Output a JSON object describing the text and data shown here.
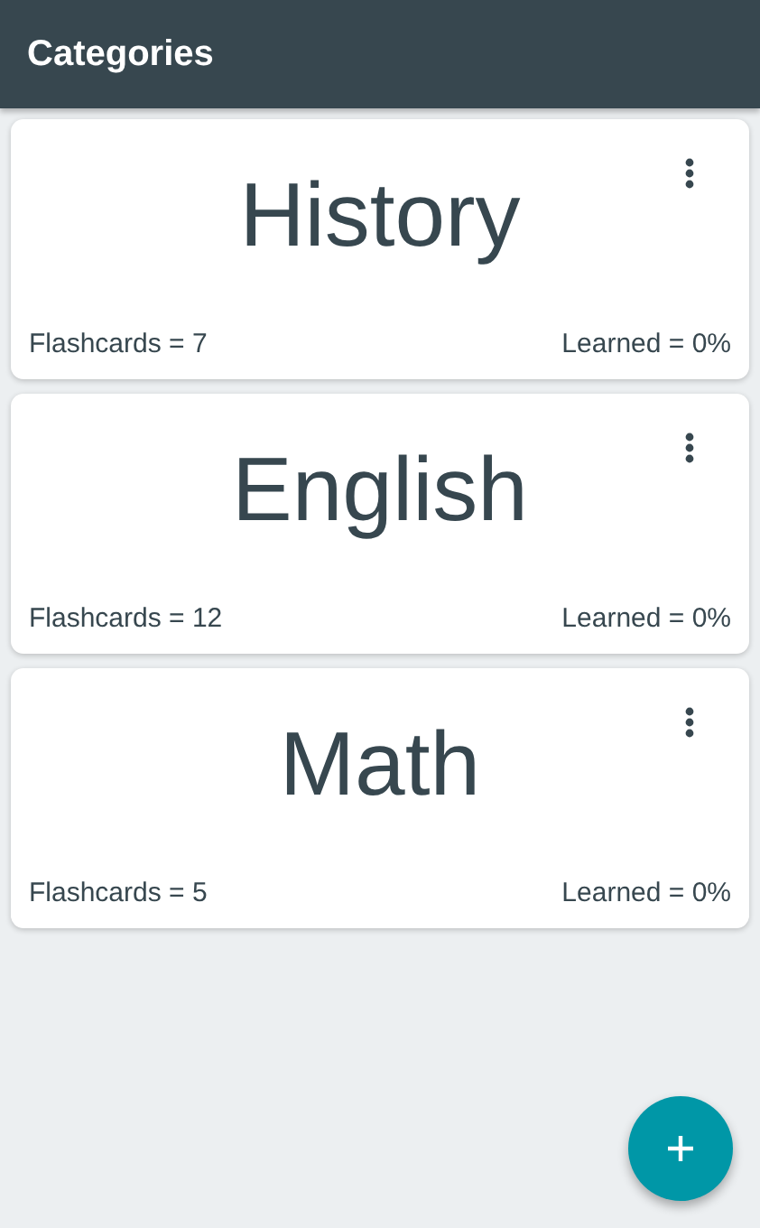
{
  "app_bar": {
    "title": "Categories"
  },
  "categories": [
    {
      "name": "History",
      "flashcards": "Flashcards = 7",
      "learned": "Learned = 0%"
    },
    {
      "name": "English",
      "flashcards": "Flashcards = 12",
      "learned": "Learned = 0%"
    },
    {
      "name": "Math",
      "flashcards": "Flashcards = 5",
      "learned": "Learned = 0%"
    }
  ]
}
